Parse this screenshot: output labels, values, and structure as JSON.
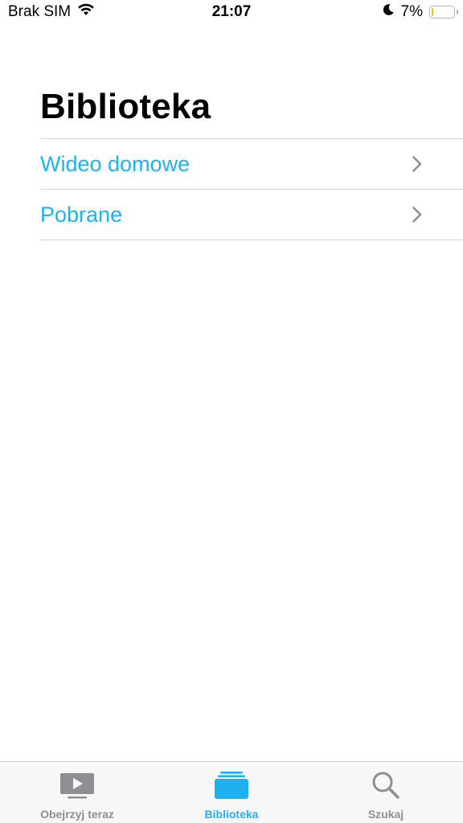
{
  "status_bar": {
    "carrier": "Brak SIM",
    "time": "21:07",
    "battery_percent_text": "7%",
    "battery_level": 0.07,
    "icons": [
      "wifi-icon",
      "moon-icon",
      "battery-icon"
    ]
  },
  "page": {
    "title": "Biblioteka"
  },
  "list": {
    "items": [
      {
        "label": "Wideo domowe",
        "icon": "chevron-right-icon"
      },
      {
        "label": "Pobrane",
        "icon": "chevron-right-icon"
      }
    ]
  },
  "tab_bar": {
    "tabs": [
      {
        "label": "Obejrzyj teraz",
        "icon": "play-screen-icon",
        "selected": false
      },
      {
        "label": "Biblioteka",
        "icon": "library-stack-icon",
        "selected": true
      },
      {
        "label": "Szukaj",
        "icon": "search-icon",
        "selected": false
      }
    ]
  },
  "colors": {
    "accent": "#1fb1ee",
    "inactive": "#8e8e93",
    "battery_low": "#f5c400",
    "separator": "#d8d8d8",
    "chevron": "#8e8e93"
  }
}
